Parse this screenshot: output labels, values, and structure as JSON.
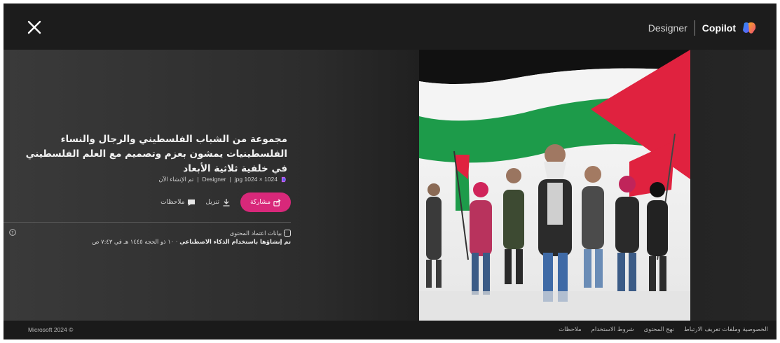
{
  "header": {
    "close_icon": "close-icon",
    "designer_label": "Designer",
    "copilot_label": "Copilot",
    "copilot_logo": "copilot-logo-icon"
  },
  "image_panel": {
    "title": "مجموعة من الشباب الفلسطيني والرجال والنساء الفلسطينيات يمشون بعزم وتصميم مع العلم الفلسطيني في خلفية ثلاثية الأبعاد",
    "meta": {
      "format": "jpg 1024 × 1024",
      "app": "Designer",
      "sep": "|",
      "created": "تم الإنشاء الآن"
    },
    "actions": {
      "share_label": "مشاركة",
      "download_label": "تنزيل",
      "feedback_label": "ملاحظات"
    },
    "credentials": {
      "heading": "بيانات اعتماد المحتوى",
      "line_bold": "تم إنشاؤها باستخدام الذكاء الاصطناعي",
      "line_rest": " · ١٠ ذو الحجة ١٤٤٥ هـ في ٧:٤٣ ص"
    },
    "colors": {
      "accent": "#d8287a",
      "background": "#1c1c1c"
    }
  },
  "footer": {
    "copyright": "Microsoft 2024 ©",
    "links": [
      "الخصوصية وملفات تعريف الارتباط",
      "نهج المحتوى",
      "شروط الاستخدام",
      "ملاحظات"
    ]
  }
}
